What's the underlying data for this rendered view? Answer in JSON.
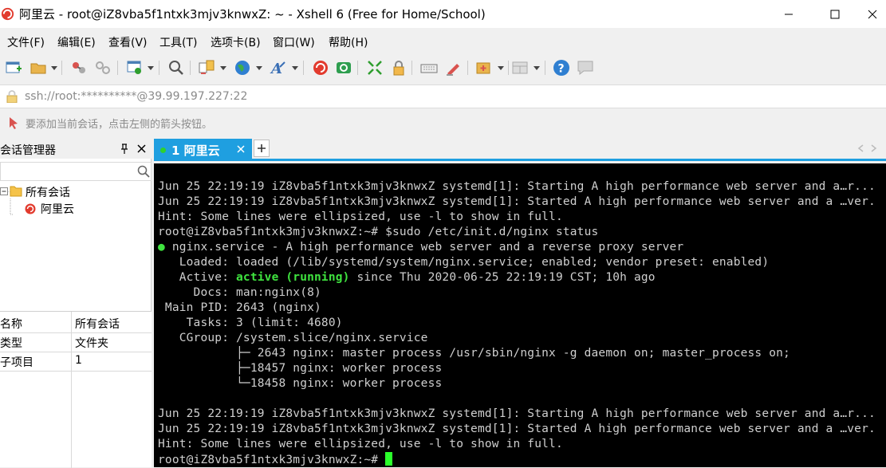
{
  "window": {
    "title": "阿里云 - root@iZ8vba5f1ntxk3mjv3knwxZ: ~ - Xshell 6 (Free for Home/School)"
  },
  "menu": [
    "文件(F)",
    "编辑(E)",
    "查看(V)",
    "工具(T)",
    "选项卡(B)",
    "窗口(W)",
    "帮助(H)"
  ],
  "address": {
    "value": "ssh://root:**********@39.99.197.227:22"
  },
  "hint": "要添加当前会话，点击左侧的箭头按钮。",
  "session_manager": {
    "title": "会话管理器",
    "tree": {
      "root": "所有会话",
      "child": "阿里云"
    },
    "properties": [
      {
        "key": "名称",
        "value": "所有会话"
      },
      {
        "key": "类型",
        "value": "文件夹"
      },
      {
        "key": "子项目",
        "value": "1"
      }
    ]
  },
  "tabs": [
    {
      "label": "1 阿里云",
      "active": true
    }
  ],
  "terminal": {
    "lines": [
      "Jun 25 22:19:19 iZ8vba5f1ntxk3mjv3knwxZ systemd[1]: Starting A high performance web server and a…r...",
      "Jun 25 22:19:19 iZ8vba5f1ntxk3mjv3knwxZ systemd[1]: Started A high performance web server and a …ver.",
      "Hint: Some lines were ellipsized, use -l to show in full.",
      "root@iZ8vba5f1ntxk3mjv3knwxZ:~# $sudo /etc/init.d/nginx status",
      "nginx.service - A high performance web server and a reverse proxy server",
      "   Loaded: loaded (/lib/systemd/system/nginx.service; enabled; vendor preset: enabled)",
      "   Active: ",
      "active (running)",
      " since Thu 2020-06-25 22:19:19 CST; 10h ago",
      "     Docs: man:nginx(8)",
      " Main PID: 2643 (nginx)",
      "    Tasks: 3 (limit: 4680)",
      "   CGroup: /system.slice/nginx.service",
      "           ├─ 2643 nginx: master process /usr/sbin/nginx -g daemon on; master_process on;",
      "           ├─18457 nginx: worker process",
      "           └─18458 nginx: worker process",
      "",
      "Jun 25 22:19:19 iZ8vba5f1ntxk3mjv3knwxZ systemd[1]: Starting A high performance web server and a…r...",
      "Jun 25 22:19:19 iZ8vba5f1ntxk3mjv3knwxZ systemd[1]: Started A high performance web server and a …ver.",
      "Hint: Some lines were ellipsized, use -l to show in full.",
      "root@iZ8vba5f1ntxk3mjv3knwxZ:~# "
    ],
    "status_dot": "●",
    "colors": {
      "background": "#000000",
      "text": "#cfcfcf",
      "highlight": "#3fe33f"
    }
  },
  "colors": {
    "accent": "#1f9fe0",
    "tab_dot": "#2fd12f"
  }
}
